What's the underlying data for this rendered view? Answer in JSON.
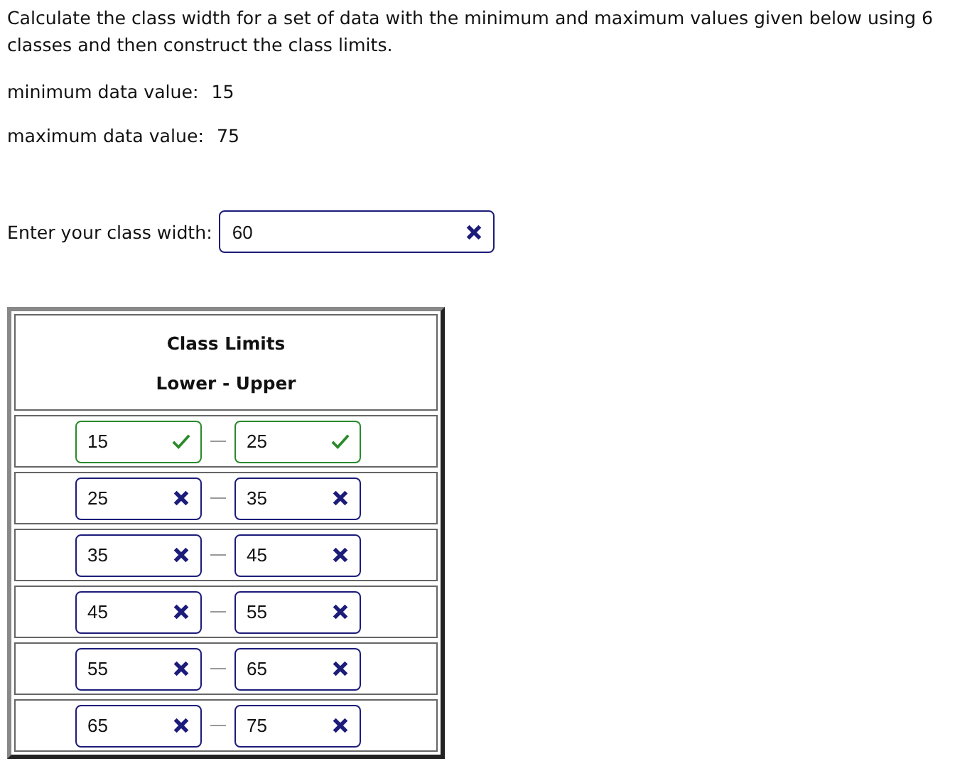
{
  "question": "Calculate the class width for a set of data with the minimum and maximum values given below using 6 classes and then construct the class limits.",
  "givens": [
    {
      "label": "minimum data value:",
      "value": "15"
    },
    {
      "label": "maximum data value:",
      "value": "75"
    }
  ],
  "class_width": {
    "label": "Enter your class width:",
    "value": "60",
    "correct": false
  },
  "table": {
    "title": "Class Limits",
    "subtitle": "Lower - Upper",
    "rows": [
      {
        "lower": {
          "value": "15",
          "correct": true
        },
        "upper": {
          "value": "25",
          "correct": true
        }
      },
      {
        "lower": {
          "value": "25",
          "correct": false
        },
        "upper": {
          "value": "35",
          "correct": false
        }
      },
      {
        "lower": {
          "value": "35",
          "correct": false
        },
        "upper": {
          "value": "45",
          "correct": false
        }
      },
      {
        "lower": {
          "value": "45",
          "correct": false
        },
        "upper": {
          "value": "55",
          "correct": false
        }
      },
      {
        "lower": {
          "value": "55",
          "correct": false
        },
        "upper": {
          "value": "65",
          "correct": false
        }
      },
      {
        "lower": {
          "value": "65",
          "correct": false
        },
        "upper": {
          "value": "75",
          "correct": false
        }
      }
    ]
  }
}
